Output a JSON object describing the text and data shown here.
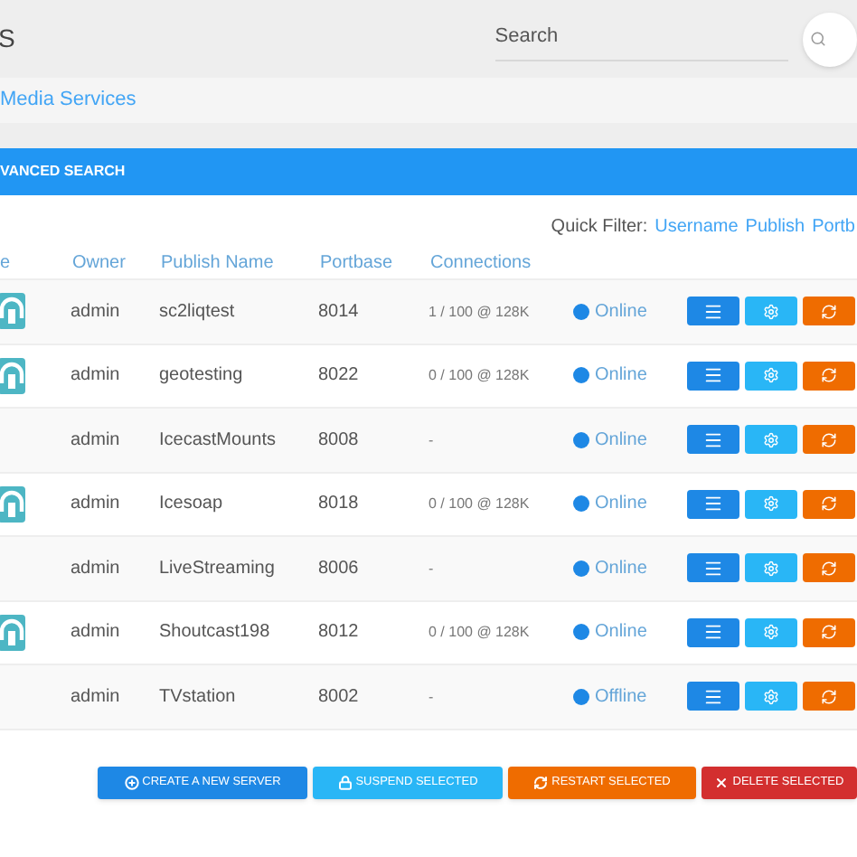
{
  "header": {
    "title": "S",
    "search": {
      "placeholder": "Search"
    }
  },
  "breadcrumb": "Media Services",
  "advanced_search": "VANCED SEARCH",
  "quick_filter": {
    "label": "Quick Filter:",
    "links": [
      "Username",
      "Publish",
      "Portb"
    ]
  },
  "table": {
    "columns": [
      "e",
      "Owner",
      "Publish Name",
      "Portbase",
      "Connections"
    ],
    "rows": [
      {
        "has_icon": true,
        "owner": "admin",
        "publish_name": "sc2liqtest",
        "portbase": "8014",
        "connections": "1 / 100 @ 128K",
        "status": "Online"
      },
      {
        "has_icon": true,
        "owner": "admin",
        "publish_name": "geotesting",
        "portbase": "8022",
        "connections": "0 / 100 @ 128K",
        "status": "Online"
      },
      {
        "has_icon": false,
        "owner": "admin",
        "publish_name": "IcecastMounts",
        "portbase": "8008",
        "connections": "-",
        "status": "Online"
      },
      {
        "has_icon": true,
        "owner": "admin",
        "publish_name": "Icesoap",
        "portbase": "8018",
        "connections": "0 / 100 @ 128K",
        "status": "Online"
      },
      {
        "has_icon": false,
        "owner": "admin",
        "publish_name": "LiveStreaming",
        "portbase": "8006",
        "connections": "-",
        "status": "Online"
      },
      {
        "has_icon": true,
        "owner": "admin",
        "publish_name": "Shoutcast198",
        "portbase": "8012",
        "connections": "0 / 100 @ 128K",
        "status": "Online"
      },
      {
        "has_icon": false,
        "owner": "admin",
        "publish_name": "TVstation",
        "portbase": "8002",
        "connections": "-",
        "status": "Offline"
      }
    ]
  },
  "actions": [
    {
      "kind": "create",
      "label": "CREATE A NEW SERVER"
    },
    {
      "kind": "suspend",
      "label": "SUSPEND SELECTED"
    },
    {
      "kind": "restart",
      "label": "RESTART SELECTED"
    },
    {
      "kind": "delete",
      "label": "DELETE SELECTED"
    }
  ]
}
